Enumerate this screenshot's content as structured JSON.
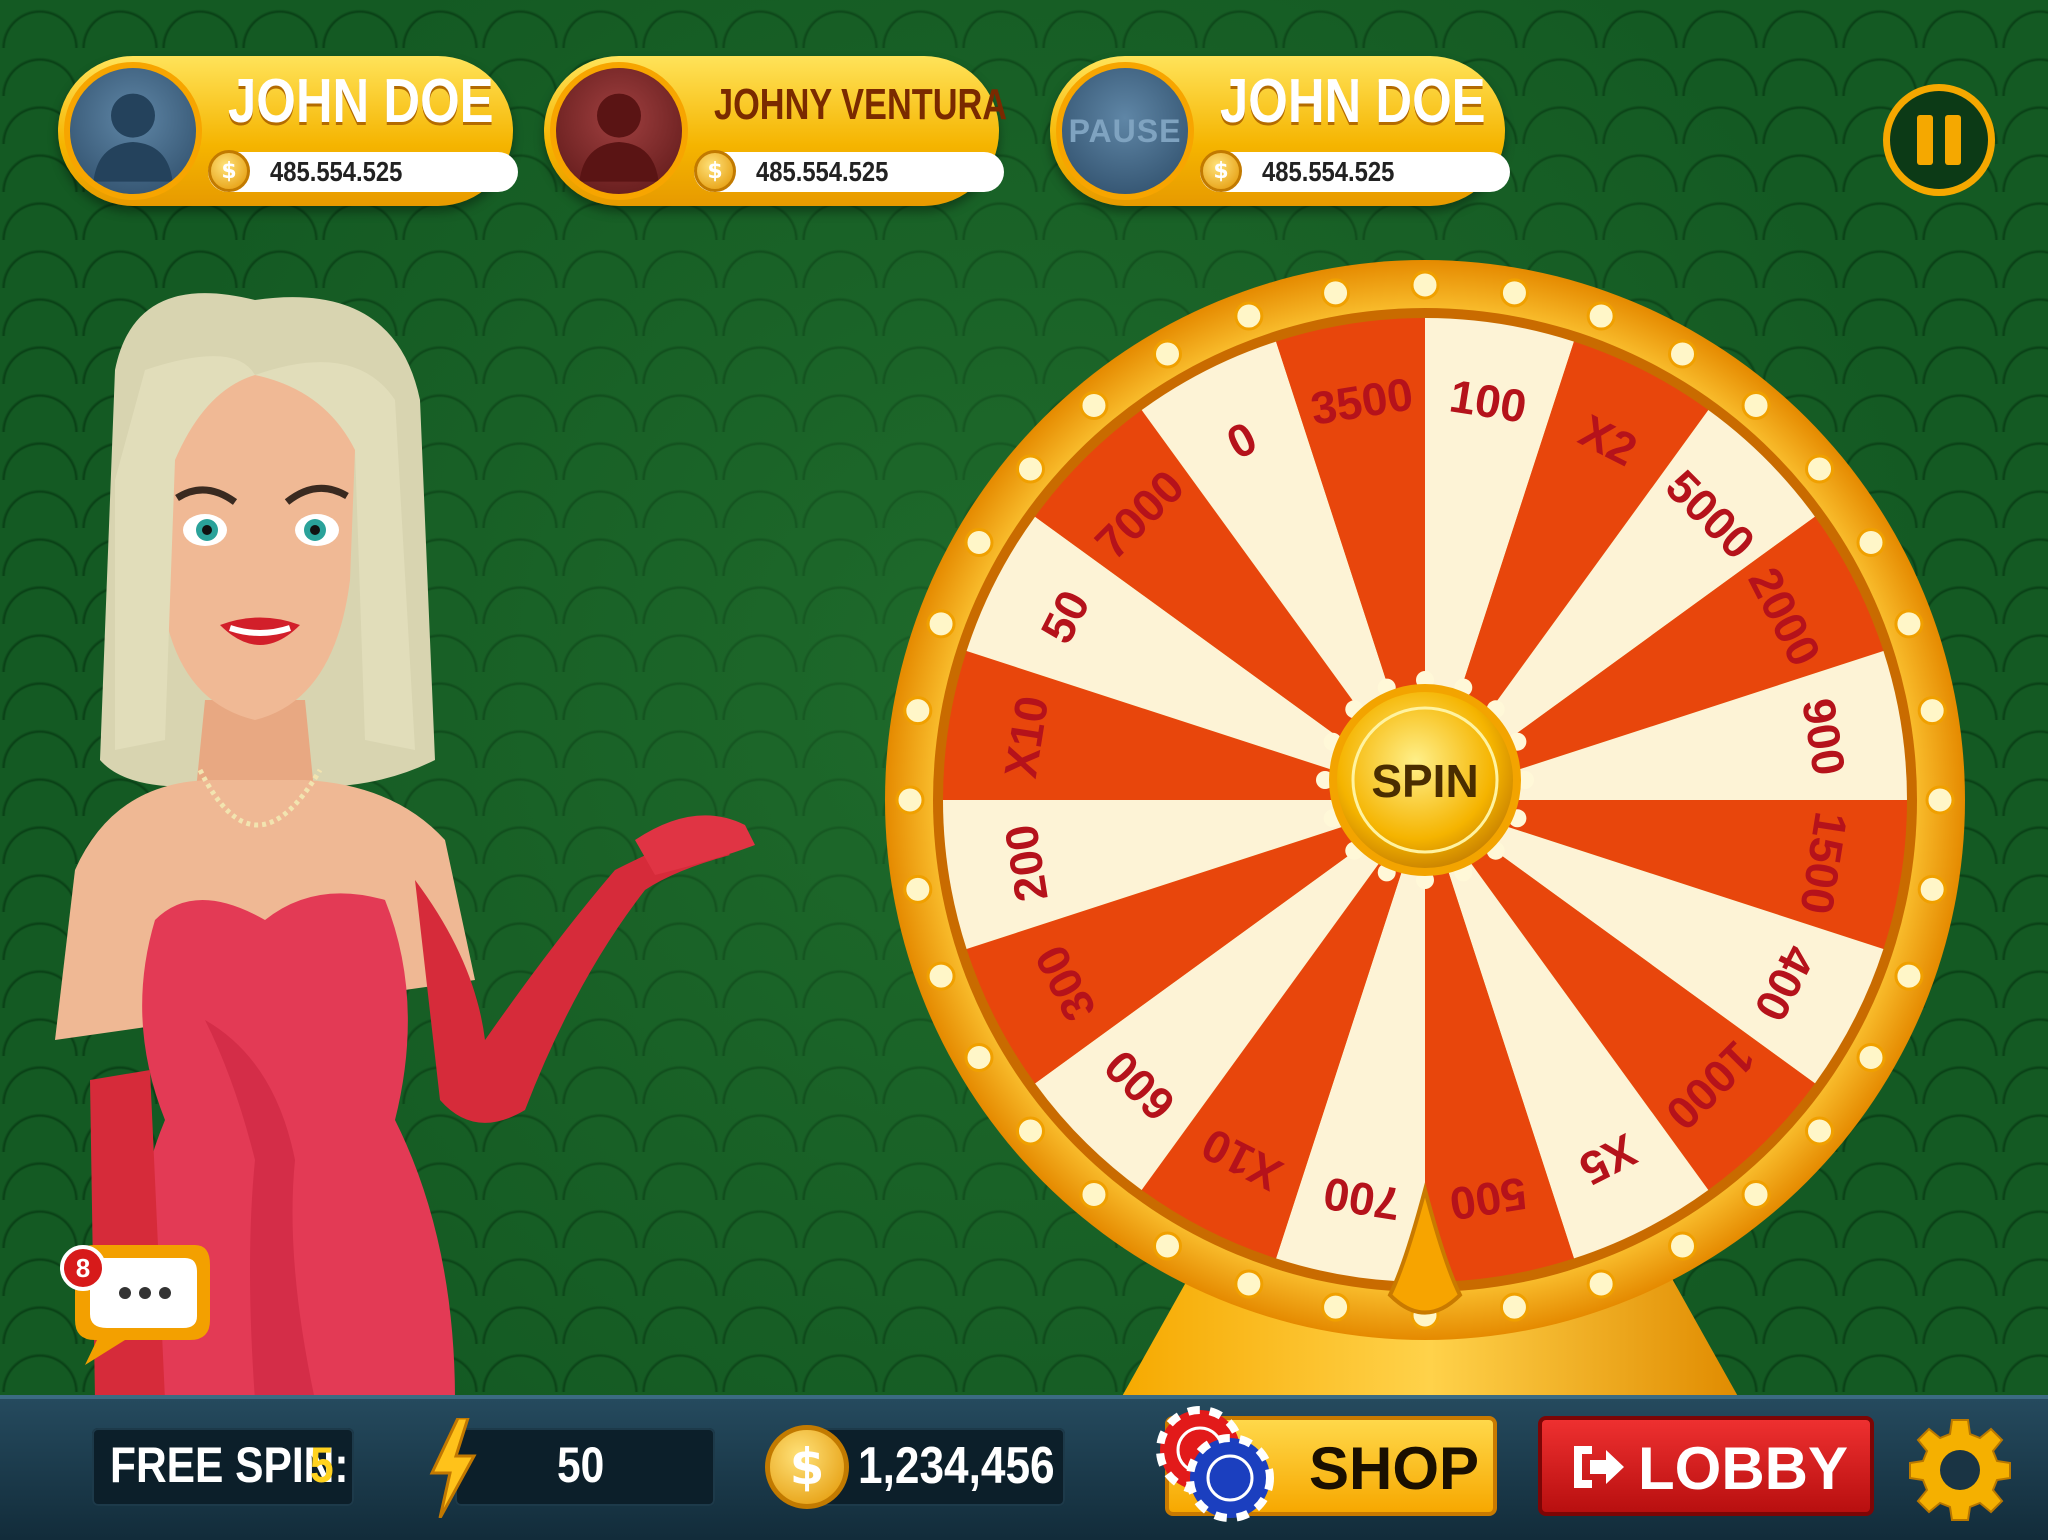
{
  "players": [
    {
      "name": "JOHN DOE",
      "coins": "485.554.525",
      "avatar": "blue"
    },
    {
      "name": "JOHNY VENTURA",
      "coins": "485.554.525",
      "avatar": "red"
    },
    {
      "name": "JOHN DOE",
      "coins": "485.554.525",
      "avatar": "pause",
      "avatar_label": "PAUSE"
    }
  ],
  "coin_symbol": "$",
  "wheel": {
    "spin_label": "SPIN",
    "segments": [
      "100",
      "X2",
      "5000",
      "2000",
      "900",
      "1500",
      "400",
      "1000",
      "X5",
      "500",
      "700",
      "X10",
      "600",
      "300",
      "200",
      "X10",
      "50",
      "7000",
      "0",
      "3500"
    ]
  },
  "chat": {
    "badge_count": "8"
  },
  "bottom": {
    "free_spin_label": "FREE SPIN:",
    "free_spin_count": "5",
    "energy_value": "50",
    "balance": "1,234,456",
    "shop_label": "SHOP",
    "lobby_label": "LOBBY"
  },
  "colors": {
    "accent_gold": "#f5a800",
    "wheel_red": "#e8460c",
    "wheel_cream": "#fdf3d6",
    "lobby_red": "#d41c1c"
  }
}
